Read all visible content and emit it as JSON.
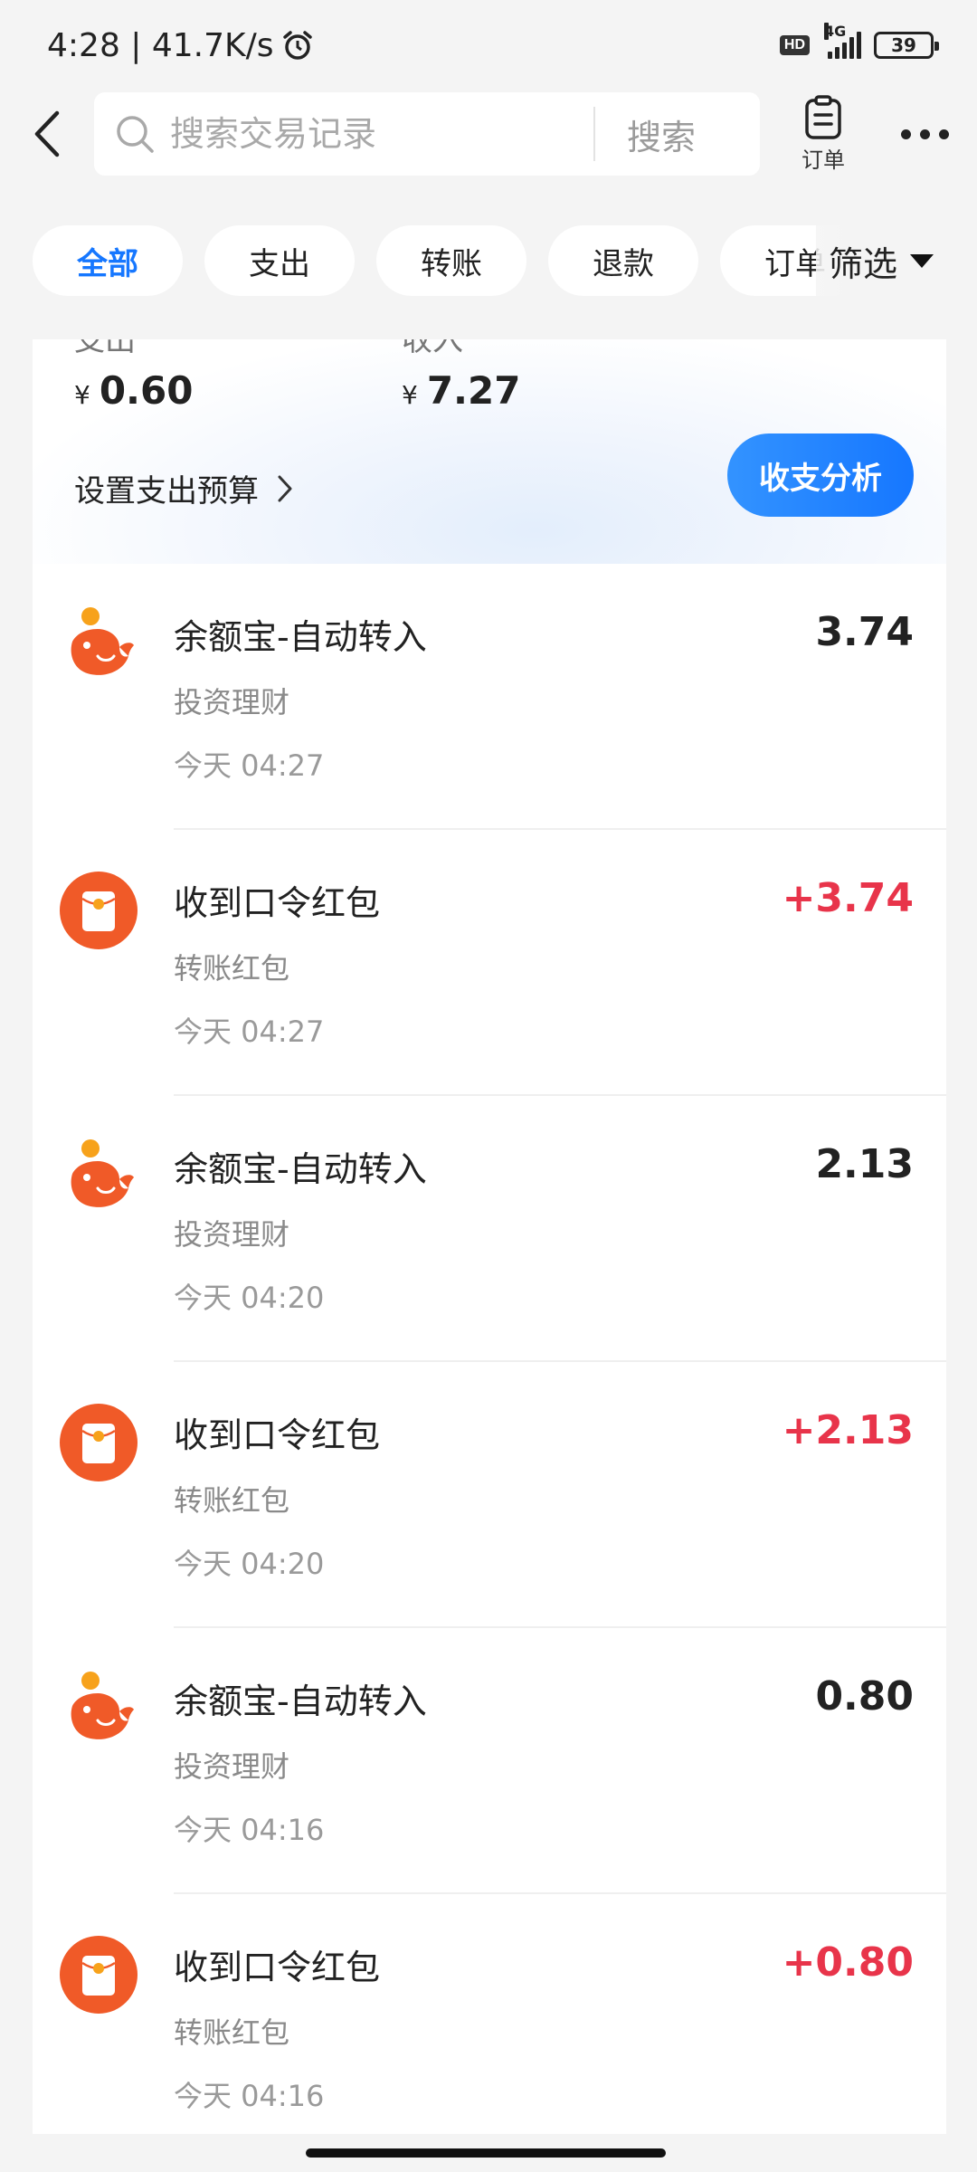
{
  "status_bar": {
    "time": "4:28",
    "speed": "41.7K/s",
    "hd": "HD",
    "network": "4G",
    "battery": "39"
  },
  "header": {
    "search_placeholder": "搜索交易记录",
    "search_button": "搜索",
    "order_label": "订单"
  },
  "tabs": [
    {
      "label": "全部",
      "active": true
    },
    {
      "label": "支出"
    },
    {
      "label": "转账"
    },
    {
      "label": "退款"
    },
    {
      "label": "订单"
    }
  ],
  "filter_label": "筛选",
  "summary": {
    "expense_label": "支出",
    "expense_currency": "¥",
    "expense_value": "0.60",
    "income_label": "收入",
    "income_currency": "¥",
    "income_value": "7.27",
    "budget_link": "设置支出预算",
    "analysis_button": "收支分析"
  },
  "transactions": [
    {
      "icon": "yuebao-icon",
      "title": "余额宝-自动转入",
      "category": "投资理财",
      "time": "今天 04:27",
      "amount": "3.74",
      "type": "neutral"
    },
    {
      "icon": "red-packet-icon",
      "title": "收到口令红包",
      "category": "转账红包",
      "time": "今天 04:27",
      "amount": "+3.74",
      "type": "income"
    },
    {
      "icon": "yuebao-icon",
      "title": "余额宝-自动转入",
      "category": "投资理财",
      "time": "今天 04:20",
      "amount": "2.13",
      "type": "neutral"
    },
    {
      "icon": "red-packet-icon",
      "title": "收到口令红包",
      "category": "转账红包",
      "time": "今天 04:20",
      "amount": "+2.13",
      "type": "income"
    },
    {
      "icon": "yuebao-icon",
      "title": "余额宝-自动转入",
      "category": "投资理财",
      "time": "今天 04:16",
      "amount": "0.80",
      "type": "neutral"
    },
    {
      "icon": "red-packet-icon",
      "title": "收到口令红包",
      "category": "转账红包",
      "time": "今天 04:16",
      "amount": "+0.80",
      "type": "income"
    }
  ],
  "colors": {
    "accent": "#1677ff",
    "income": "#e8344a",
    "icon_orange": "#f05a28"
  }
}
